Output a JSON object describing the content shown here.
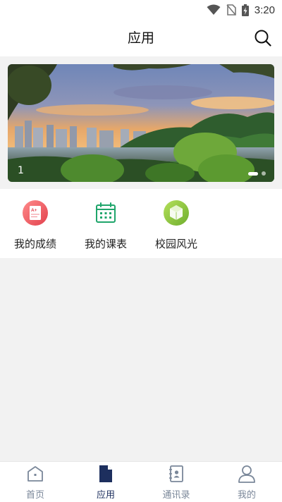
{
  "status_bar": {
    "time": "3:20"
  },
  "header": {
    "title": "应用"
  },
  "banner": {
    "page_number": "1",
    "total_dots": 2,
    "active_dot": 1
  },
  "apps": [
    {
      "label": "我的成绩",
      "icon": "grade-report-icon"
    },
    {
      "label": "我的课表",
      "icon": "calendar-icon"
    },
    {
      "label": "校园风光",
      "icon": "campus-cube-icon"
    }
  ],
  "tabs": [
    {
      "label": "首页",
      "icon": "home-icon",
      "active": false
    },
    {
      "label": "应用",
      "icon": "document-icon",
      "active": true
    },
    {
      "label": "通讯录",
      "icon": "contacts-book-icon",
      "active": false
    },
    {
      "label": "我的",
      "icon": "user-icon",
      "active": false
    }
  ],
  "colors": {
    "tab_active": "#1d2f5e",
    "tab_inactive": "#7a8799",
    "calendar_green": "#1fa56b",
    "grade_red": "#e8525b",
    "campus_green": "#8cc43c"
  }
}
